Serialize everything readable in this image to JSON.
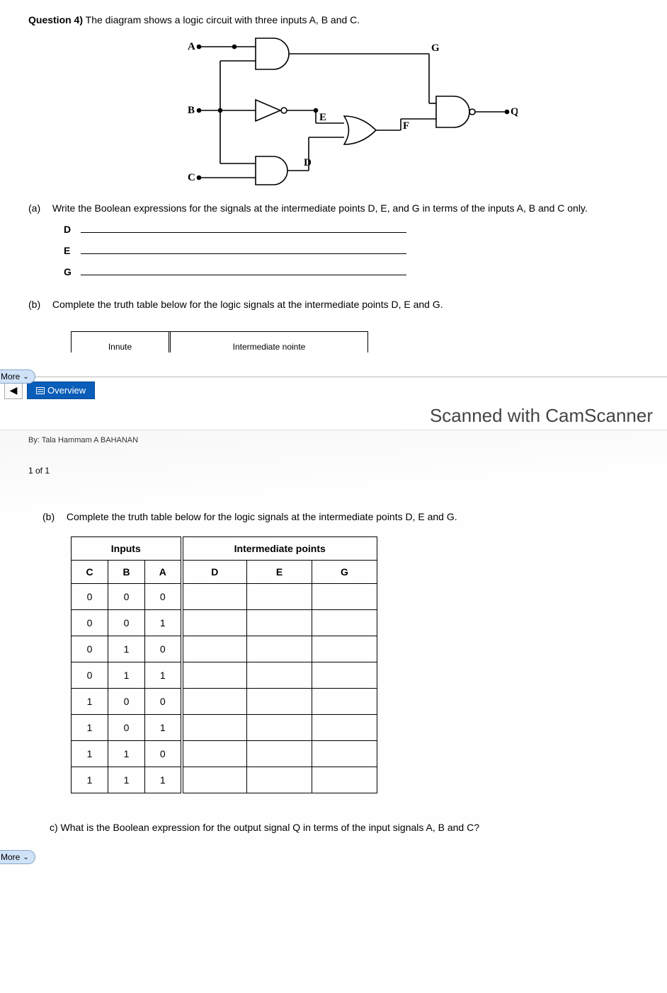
{
  "question": {
    "label": "Question 4)",
    "text": "The diagram shows a logic circuit with three inputs A, B and C."
  },
  "circuit": {
    "inputs": [
      "A",
      "B",
      "C"
    ],
    "nodes": [
      "D",
      "E",
      "F",
      "G"
    ],
    "output": "Q"
  },
  "partA": {
    "label": "(a)",
    "text": "Write the Boolean expressions for the signals at the intermediate points D, E, and G in terms of the inputs A, B and C only.",
    "lines": [
      "D",
      "E",
      "G"
    ]
  },
  "partB": {
    "label": "(b)",
    "text": "Complete the truth table below for the logic signals at the intermediate points D, E and G."
  },
  "cutoffTable": {
    "col1": "Innute",
    "col2": "Intermediate nointe"
  },
  "moreLabel": "More",
  "tabs": {
    "arrow": "◀",
    "overview": "Overview"
  },
  "watermark": "Scanned with CamScanner",
  "page2": {
    "byline": "By: Tala Hammam A BAHANAN",
    "pagenum": "1 of 1",
    "partB": {
      "label": "(b)",
      "text": "Complete the truth table below for the logic signals at the intermediate points D, E and G."
    },
    "table": {
      "group1": "Inputs",
      "group2": "Intermediate points",
      "headers": [
        "C",
        "B",
        "A",
        "D",
        "E",
        "G"
      ],
      "rows": [
        [
          "0",
          "0",
          "0",
          "",
          "",
          ""
        ],
        [
          "0",
          "0",
          "1",
          "",
          "",
          ""
        ],
        [
          "0",
          "1",
          "0",
          "",
          "",
          ""
        ],
        [
          "0",
          "1",
          "1",
          "",
          "",
          ""
        ],
        [
          "1",
          "0",
          "0",
          "",
          "",
          ""
        ],
        [
          "1",
          "0",
          "1",
          "",
          "",
          ""
        ],
        [
          "1",
          "1",
          "0",
          "",
          "",
          ""
        ],
        [
          "1",
          "1",
          "1",
          "",
          "",
          ""
        ]
      ]
    },
    "partC": "c) What is the Boolean expression for the output signal Q in terms of the input signals A, B and C?"
  }
}
